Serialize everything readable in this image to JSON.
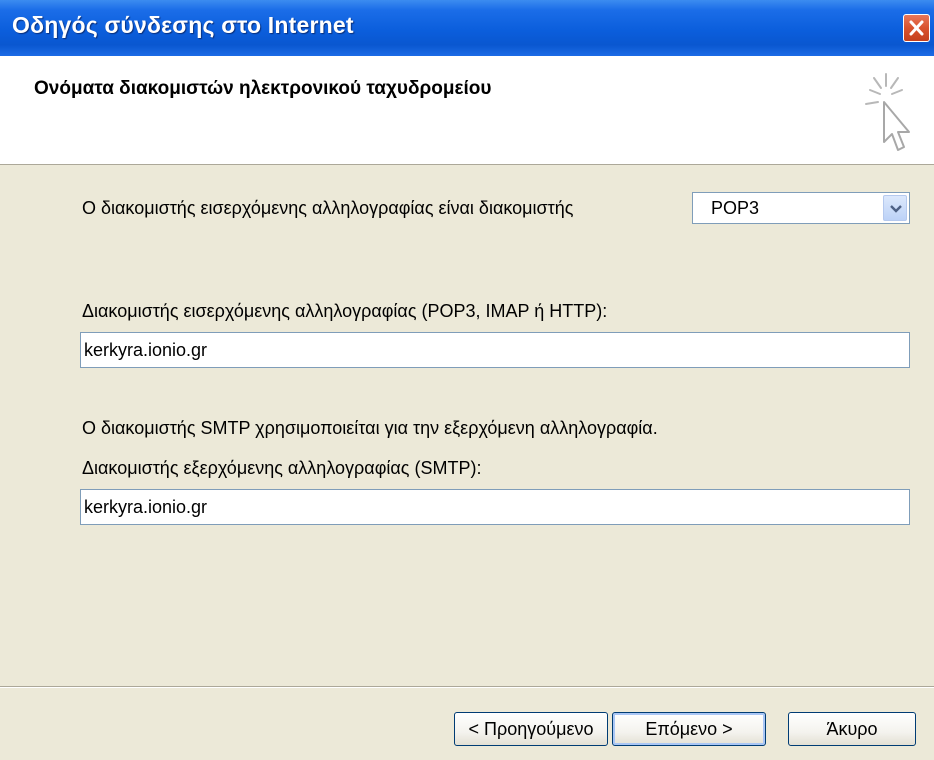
{
  "window": {
    "title": "Οδηγός σύνδεσης στο Internet",
    "close_icon": "close-icon"
  },
  "header": {
    "heading": "Ονόματα διακομιστών ηλεκτρονικού ταχυδρομείου",
    "icon": "wizard-cursor-icon"
  },
  "form": {
    "server_type_label": "Ο διακομιστής εισερχόμενης αλληλογραφίας είναι διακομιστής",
    "server_type_value": "POP3",
    "incoming_label": "Διακομιστής εισερχόμενης αλληλογραφίας (POP3, IMAP ή HTTP):",
    "incoming_value": "kerkyra.ionio.gr",
    "smtp_note": "Ο διακομιστής SMTP χρησιμοποιείται για την εξερχόμενη αλληλογραφία.",
    "outgoing_label": "Διακομιστής εξερχόμενης αλληλογραφίας (SMTP):",
    "outgoing_value": "kerkyra.ionio.gr"
  },
  "buttons": {
    "back": "< Προηγούμενο",
    "next": "Επόμενο >",
    "cancel": "Άκυρο"
  },
  "colors": {
    "titlebar": "#0B5EDC",
    "dialog_bg": "#ECE9D8",
    "close": "#D9532E"
  }
}
